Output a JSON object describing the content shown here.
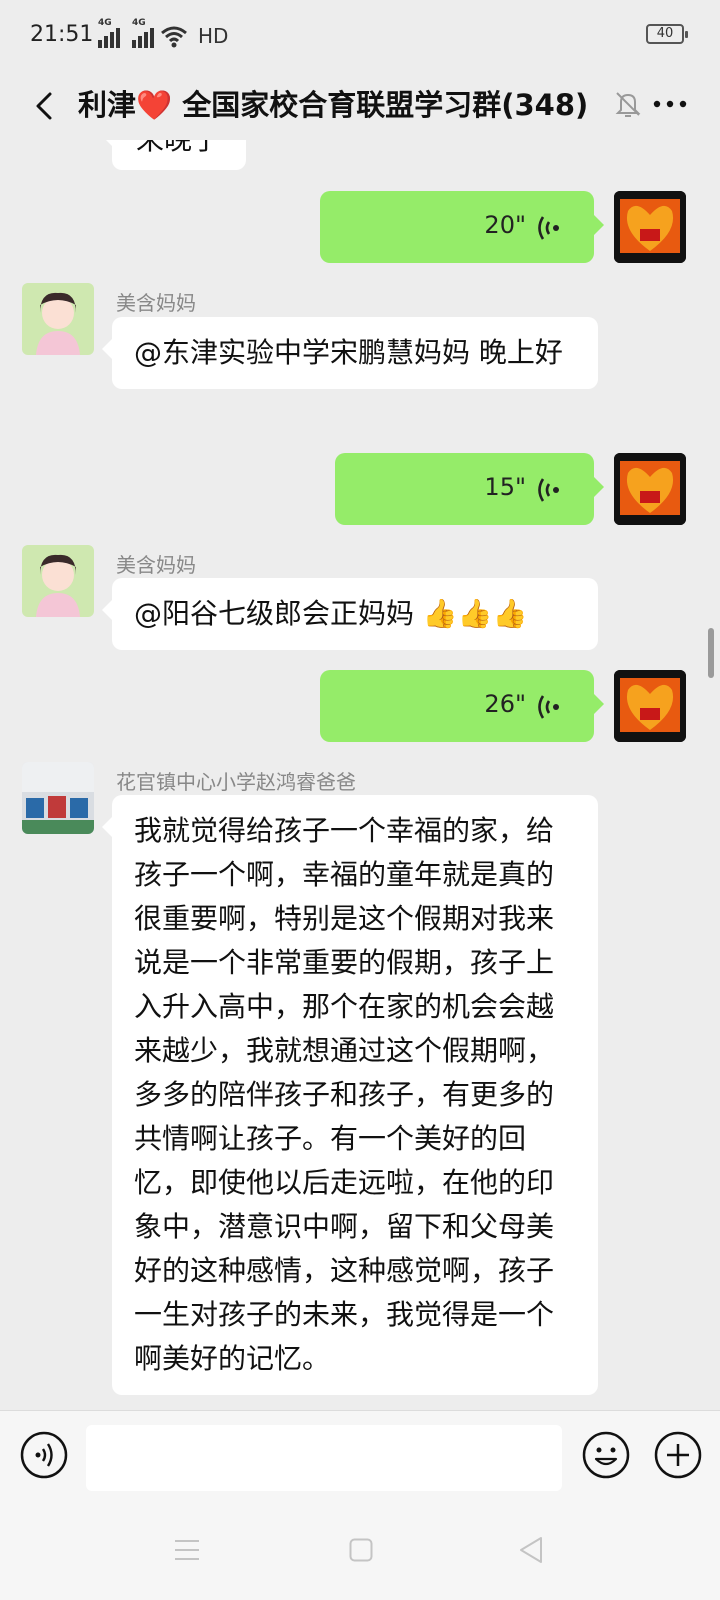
{
  "status_bar": {
    "time": "21:51",
    "signal1_label": "4G",
    "signal2_label": "4G",
    "hd_label": "HD",
    "battery": "40"
  },
  "header": {
    "title": "利津❤️ 全国家校合育联盟学习群(348)"
  },
  "chat": {
    "partial_top_text": "来晚了",
    "messages": [
      {
        "type": "voice",
        "direction": "out",
        "duration": "20\""
      },
      {
        "type": "text",
        "direction": "in",
        "sender": "美含妈妈",
        "text": "@东津实验中学宋鹏慧妈妈  晚上好"
      },
      {
        "type": "voice",
        "direction": "out",
        "duration": "15\""
      },
      {
        "type": "text",
        "direction": "in",
        "sender": "美含妈妈",
        "text": "@阳谷七级郎会正妈妈 👍👍👍"
      },
      {
        "type": "voice",
        "direction": "out",
        "duration": "26\""
      },
      {
        "type": "text",
        "direction": "in",
        "sender": "花官镇中心小学赵鸿睿爸爸",
        "text": "我就觉得给孩子一个幸福的家，给孩子一个啊，幸福的童年就是真的很重要啊，特别是这个假期对我来说是一个非常重要的假期，孩子上入升入高中，那个在家的机会会越来越少，我就想通过这个假期啊，多多的陪伴孩子和孩子，有更多的共情啊让孩子。有一个美好的回忆，即使他以后走远啦，在他的印象中，潜意识中啊，留下和父母美好的这种感情，这种感觉啊，孩子一生对孩子的未来，我觉得是一个啊美好的记忆。"
      }
    ]
  },
  "colors": {
    "background": "#ededed",
    "outgoing_bubble": "#95ec69",
    "incoming_bubble": "#ffffff"
  },
  "icons": {
    "back": "chevron-left-icon",
    "mute": "bell-off-icon",
    "more": "more-dots-icon",
    "voice": "voice-wave-icon",
    "emoji": "smiley-icon",
    "plus": "plus-circle-icon"
  }
}
